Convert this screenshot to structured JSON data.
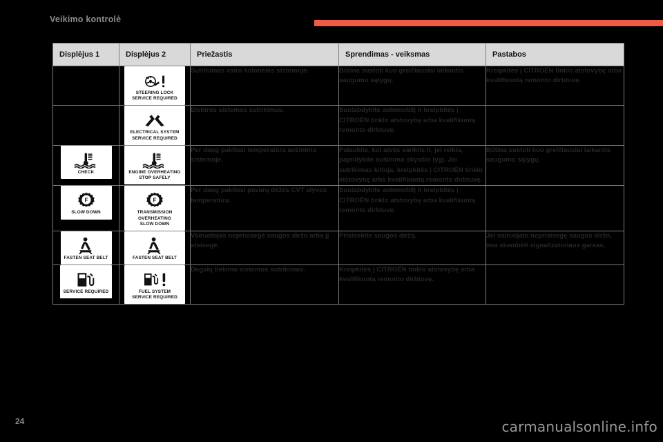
{
  "header": {
    "section_title": "Veikimo kontrolė",
    "accent_color": "#ef5b45"
  },
  "table": {
    "columns": [
      "Displėjus 1",
      "Displėjus 2",
      "Priežastis",
      "Sprendimas - veiksmas",
      "Pastabos"
    ],
    "rows": [
      {
        "display1": null,
        "display2": {
          "icon": "steering-lock-icon",
          "caption": "STEERING LOCK\nSERVICE REQUIRED"
        },
        "cause": "Sutrikimas vairo kolonėlės sistemoje.",
        "solution": "Būtina sustoti kuo greičiausiai laikantis saugumo sąlygų.",
        "note": "Kreipkitės į CITROËN tinklo atstovybę arba kvalifikuotą remonto dirbtuvę."
      },
      {
        "display1": null,
        "display2": {
          "icon": "electrical-system-icon",
          "caption": "ELECTRICAL SYSTEM\nSERVICE REQUIRED"
        },
        "cause": "Elektros sistemos sutrikimas.",
        "solution": "Sustabdykite automobilį ir kreipkitės į CITROËN tinklo atstovybę arba kvalifikuotą remonto dirbtuvę.",
        "note": ""
      },
      {
        "display1": {
          "icon": "coolant-temperature-icon",
          "caption": "CHECK"
        },
        "display2": {
          "icon": "coolant-temperature-icon",
          "caption": "ENGINE OVERHEATING\nSTOP SAFELY"
        },
        "cause": "Per daug pakilusi temperatūra aušinimo sistemoje.",
        "solution": "Palaukite, kol atvės variklis ir, jei reikia, papildykite aušinimo skysčio lygį. Jei sutrikimas kiltoja, kreipkitės į CITROËN tinklo atstovybę arba kvalifikuotą remonto dirbtuvę.",
        "note": "Būtina sustoti kuo greičiausiai laikantis saugumo sąlygų."
      },
      {
        "display1": {
          "icon": "transmission-gear-icon",
          "caption": "SLOW DOWN"
        },
        "display2": {
          "icon": "transmission-gear-icon",
          "caption": "TRANSMISSION\nOVERHEATING\nSLOW DOWN"
        },
        "cause": "Per daug pakilusi pavarų dėžės CVT alyvos temperatūra.",
        "solution": "Sustabdykite automobilį ir kreipkitės į CITROËN tinklo atstovybę arba kvalifikuotą remonto dirbtuvę.",
        "note": ""
      },
      {
        "display1": {
          "icon": "seat-belt-icon",
          "caption": "FASTEN SEAT BELT"
        },
        "display2": {
          "icon": "seat-belt-icon",
          "caption": "FASTEN SEAT BELT"
        },
        "cause": "Vairuotojas neprisisegė saugos diržo arba jį atsisegė.",
        "solution": "Prisisekite saugos diržą.",
        "note": "Jei vairuojate neprisisegę saugos diržo, ima skambėti signalizatoriaus garsas."
      },
      {
        "display1": {
          "icon": "fuel-pump-icon",
          "caption": "SERVICE REQUIRED"
        },
        "display2": {
          "icon": "fuel-pump-alert-icon",
          "caption": "FUEL SYSTEM\nSERVICE REQUIRED"
        },
        "cause": "Degalų tiekimo sistemos sutrikimas.",
        "solution": "Kreipkitės į CITROËN tinklo atstovybę arba kvalifikuotą remonto dirbtuvę.",
        "note": ""
      }
    ]
  },
  "footer": {
    "page_number": "24",
    "watermark": "carmanualsonline.info"
  }
}
